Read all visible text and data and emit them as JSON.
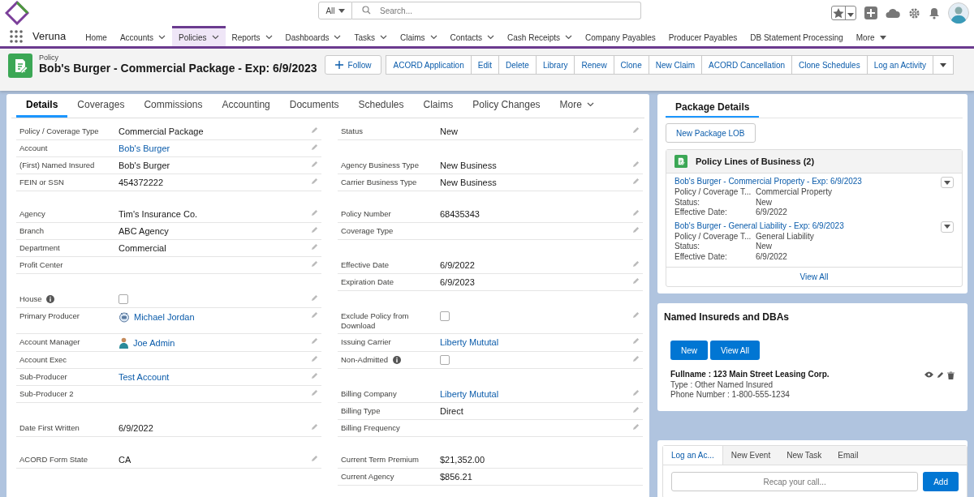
{
  "top_bar": {
    "search": {
      "scope": "All",
      "placeholder": "Search..."
    }
  },
  "nav": {
    "app_name": "Veruna",
    "items": [
      {
        "label": "Home",
        "dropdown": false,
        "selected": false
      },
      {
        "label": "Accounts",
        "dropdown": true,
        "selected": false
      },
      {
        "label": "Policies",
        "dropdown": true,
        "selected": true
      },
      {
        "label": "Reports",
        "dropdown": true,
        "selected": false
      },
      {
        "label": "Dashboards",
        "dropdown": true,
        "selected": false
      },
      {
        "label": "Tasks",
        "dropdown": true,
        "selected": false
      },
      {
        "label": "Claims",
        "dropdown": true,
        "selected": false
      },
      {
        "label": "Contacts",
        "dropdown": true,
        "selected": false
      },
      {
        "label": "Cash Receipts",
        "dropdown": true,
        "selected": false
      },
      {
        "label": "Company Payables",
        "dropdown": false,
        "selected": false
      },
      {
        "label": "Producer Payables",
        "dropdown": false,
        "selected": false
      },
      {
        "label": "DB Statement Processing",
        "dropdown": false,
        "selected": false
      },
      {
        "label": "More",
        "dropdown": true,
        "selected": false
      }
    ]
  },
  "record": {
    "object_label": "Policy",
    "title": "Bob's Burger - Commercial Package - Exp: 6/9/2023",
    "actions": [
      {
        "label": "Follow",
        "kind": "follow"
      },
      {
        "label": "ACORD Application",
        "kind": "action"
      },
      {
        "label": "Edit",
        "kind": "action"
      },
      {
        "label": "Delete",
        "kind": "action"
      },
      {
        "label": "Library",
        "kind": "action"
      },
      {
        "label": "Renew",
        "kind": "action"
      },
      {
        "label": "Clone",
        "kind": "action"
      },
      {
        "label": "New Claim",
        "kind": "action"
      },
      {
        "label": "ACORD Cancellation",
        "kind": "action"
      },
      {
        "label": "Clone Schedules",
        "kind": "action"
      },
      {
        "label": "Log an Activity",
        "kind": "action"
      }
    ]
  },
  "tabs": [
    {
      "label": "Details",
      "selected": true,
      "dropdown": false
    },
    {
      "label": "Coverages",
      "selected": false,
      "dropdown": false
    },
    {
      "label": "Commissions",
      "selected": false,
      "dropdown": false
    },
    {
      "label": "Accounting",
      "selected": false,
      "dropdown": false
    },
    {
      "label": "Documents",
      "selected": false,
      "dropdown": false
    },
    {
      "label": "Schedules",
      "selected": false,
      "dropdown": false
    },
    {
      "label": "Claims",
      "selected": false,
      "dropdown": false
    },
    {
      "label": "Policy Changes",
      "selected": false,
      "dropdown": false
    },
    {
      "label": "More",
      "selected": false,
      "dropdown": true
    }
  ],
  "details": {
    "rows": [
      {
        "kind": "fields",
        "left": {
          "label": "Policy / Coverage Type",
          "kind": "text",
          "value": "Commercial Package",
          "editable": true
        },
        "right": {
          "label": "Status",
          "kind": "text",
          "value": "New",
          "editable": true
        }
      },
      {
        "kind": "fields",
        "left": {
          "label": "Account",
          "kind": "link",
          "value": "Bob's Burger",
          "editable": true
        }
      },
      {
        "kind": "fields",
        "left": {
          "label": "(First) Named Insured",
          "kind": "text",
          "value": "Bob's Burger",
          "editable": true
        },
        "right": {
          "label": "Agency Business Type",
          "kind": "text",
          "value": "New Business",
          "editable": true
        }
      },
      {
        "kind": "fields",
        "left": {
          "label": "FEIN or SSN",
          "kind": "text",
          "value": "454372222",
          "editable": true
        },
        "right": {
          "label": "Carrier Business Type",
          "kind": "text",
          "value": "New Business",
          "editable": true
        }
      },
      {
        "kind": "gap"
      },
      {
        "kind": "fields",
        "left": {
          "label": "Agency",
          "kind": "text",
          "value": "Tim's Insurance Co.",
          "editable": true
        },
        "right": {
          "label": "Policy Number",
          "kind": "text",
          "value": "68435343",
          "editable": true
        }
      },
      {
        "kind": "fields",
        "left": {
          "label": "Branch",
          "kind": "text",
          "value": "ABC Agency",
          "editable": true
        },
        "right": {
          "label": "Coverage Type",
          "kind": "text",
          "editable": true
        }
      },
      {
        "kind": "fields",
        "left": {
          "label": "Department",
          "kind": "text",
          "value": "Commercial",
          "editable": true
        }
      },
      {
        "kind": "fields",
        "left": {
          "label": "Profit Center",
          "kind": "text",
          "editable": true
        },
        "right": {
          "label": "Effective Date",
          "kind": "text",
          "value": "6/9/2022",
          "editable": true
        }
      },
      {
        "kind": "fields",
        "right": {
          "label": "Expiration Date",
          "kind": "text",
          "value": "6/9/2023",
          "editable": true
        }
      },
      {
        "kind": "fields",
        "left": {
          "label": "House",
          "kind": "checkbox",
          "checked": false,
          "info": true,
          "editable": true
        }
      },
      {
        "kind": "fields",
        "left": {
          "label": "Primary Producer",
          "kind": "bot_user",
          "value": "Michael Jordan",
          "editable": true
        },
        "right": {
          "label": "Exclude Policy from Download",
          "kind": "checkbox",
          "checked": false,
          "editable": true
        }
      },
      {
        "kind": "fields",
        "left": {
          "label": "Account Manager",
          "kind": "user",
          "value": "Joe Admin",
          "editable": true
        },
        "right": {
          "label": "Issuing Carrier",
          "kind": "link",
          "value": "Liberty Mututal",
          "editable": true
        }
      },
      {
        "kind": "fields",
        "left": {
          "label": "Account Exec",
          "kind": "text",
          "editable": true
        },
        "right": {
          "label": "Non-Admitted",
          "kind": "checkbox",
          "checked": false,
          "info": true,
          "editable": true
        }
      },
      {
        "kind": "fields",
        "left": {
          "label": "Sub-Producer",
          "kind": "link",
          "value": "Test Account",
          "editable": true
        }
      },
      {
        "kind": "fields",
        "left": {
          "label": "Sub-Producer 2",
          "kind": "text",
          "editable": true
        },
        "right": {
          "label": "Billing Company",
          "kind": "link",
          "value": "Liberty Mututal",
          "editable": true
        }
      },
      {
        "kind": "fields",
        "right": {
          "label": "Billing Type",
          "kind": "text",
          "value": "Direct",
          "editable": true
        }
      },
      {
        "kind": "fields",
        "left": {
          "label": "Date First Written",
          "kind": "text",
          "value": "6/9/2022",
          "editable": true
        },
        "right": {
          "label": "Billing Frequency",
          "kind": "text",
          "editable": true
        }
      },
      {
        "kind": "gap"
      },
      {
        "kind": "fields",
        "left": {
          "label": "ACORD Form State",
          "kind": "text",
          "value": "CA",
          "editable": true
        },
        "right": {
          "label": "Current Term Premium",
          "kind": "text",
          "value": "$21,352.00",
          "editable": false
        }
      },
      {
        "kind": "fields",
        "right": {
          "label": "Current Agency",
          "kind": "text",
          "value": "$856.21",
          "editable": false
        }
      }
    ]
  },
  "package_details": {
    "tab": {
      "label": "Package Details",
      "selected": true
    },
    "new_button": "New Package LOB",
    "related_list": {
      "title": "Policy Lines of Business (2)",
      "items": [
        {
          "title": "Bob's Burger - Commercial Property - Exp: 6/9/2023",
          "fields": [
            {
              "label": "Policy / Coverage T...",
              "value": "Commercial Property"
            },
            {
              "label": "Status:",
              "value": "New"
            },
            {
              "label": "Effective Date:",
              "value": "6/9/2022"
            }
          ]
        },
        {
          "title": "Bob's Burger - General Liability - Exp: 6/9/2023",
          "fields": [
            {
              "label": "Policy / Coverage T...",
              "value": "General Liability"
            },
            {
              "label": "Status:",
              "value": "New"
            },
            {
              "label": "Effective Date:",
              "value": "6/9/2022"
            }
          ]
        }
      ],
      "footer": "View All"
    }
  },
  "named_insureds": {
    "title": "Named Insureds and DBAs",
    "buttons": [
      "New",
      "View All"
    ],
    "records": [
      {
        "heading": "Fullname : 123 Main Street Leasing Corp.",
        "lines": [
          "Type : Other Named Insured",
          "Phone Number : 1-800-555-1234"
        ]
      }
    ]
  },
  "activity": {
    "tabs": [
      {
        "label": "Log an Ac...",
        "selected": true
      },
      {
        "label": "New Event",
        "selected": false
      },
      {
        "label": "New Task",
        "selected": false
      },
      {
        "label": "Email",
        "selected": false
      }
    ],
    "placeholder": "Recap your call...",
    "button": "Add"
  }
}
